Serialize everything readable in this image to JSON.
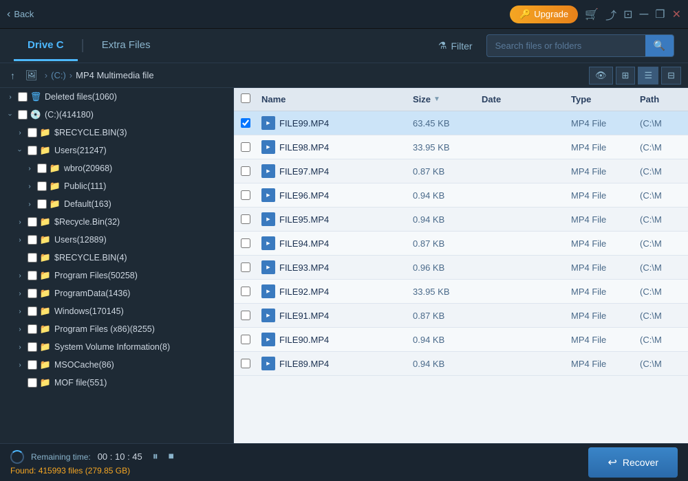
{
  "titleBar": {
    "backLabel": "Back",
    "upgradeLabel": "Upgrade",
    "upgradeIcon": "🔑"
  },
  "tabs": {
    "driveC": "Drive C",
    "extraFiles": "Extra Files",
    "filter": "Filter"
  },
  "search": {
    "placeholder": "Search files or folders"
  },
  "breadcrumb": {
    "up": "↑",
    "image": "🖼",
    "drive": "(C:)",
    "folder": "MP4 Multimedia file"
  },
  "viewModes": [
    "👁",
    "⊞",
    "☰",
    "⊟"
  ],
  "tree": {
    "items": [
      {
        "id": "deleted",
        "label": "Deleted files(1060)",
        "indent": 1,
        "type": "trash",
        "toggleState": "collapsed",
        "level": 0
      },
      {
        "id": "driveC",
        "label": "(C:)(414180)",
        "indent": 1,
        "type": "drive",
        "toggleState": "expanded",
        "level": 0
      },
      {
        "id": "srecycle1",
        "label": "$RECYCLE.BIN(3)",
        "indent": 2,
        "type": "folder",
        "toggleState": "collapsed",
        "level": 1
      },
      {
        "id": "users1",
        "label": "Users(21247)",
        "indent": 2,
        "type": "folder",
        "toggleState": "expanded",
        "level": 1
      },
      {
        "id": "wbro",
        "label": "wbro(20968)",
        "indent": 3,
        "type": "folder",
        "toggleState": "collapsed",
        "level": 2
      },
      {
        "id": "public",
        "label": "Public(111)",
        "indent": 3,
        "type": "folder",
        "toggleState": "collapsed",
        "level": 2
      },
      {
        "id": "default",
        "label": "Default(163)",
        "indent": 3,
        "type": "folder",
        "toggleState": "collapsed",
        "level": 2
      },
      {
        "id": "srecycle2",
        "label": "$Recycle.Bin(32)",
        "indent": 2,
        "type": "folder",
        "toggleState": "collapsed",
        "level": 1
      },
      {
        "id": "users2",
        "label": "Users(12889)",
        "indent": 2,
        "type": "folder",
        "toggleState": "collapsed",
        "level": 1
      },
      {
        "id": "srecycle3",
        "label": "$RECYCLE.BIN(4)",
        "indent": 2,
        "type": "folder",
        "toggleState": "none",
        "level": 1
      },
      {
        "id": "programFiles",
        "label": "Program Files(50258)",
        "indent": 2,
        "type": "folder",
        "toggleState": "collapsed",
        "level": 1
      },
      {
        "id": "programData",
        "label": "ProgramData(1436)",
        "indent": 2,
        "type": "folder",
        "toggleState": "collapsed",
        "level": 1
      },
      {
        "id": "windows",
        "label": "Windows(170145)",
        "indent": 2,
        "type": "folder",
        "toggleState": "collapsed",
        "level": 1
      },
      {
        "id": "programFilesX86",
        "label": "Program Files (x86)(8255)",
        "indent": 2,
        "type": "folder",
        "toggleState": "collapsed",
        "level": 1
      },
      {
        "id": "sysVol",
        "label": "System Volume Information(8)",
        "indent": 2,
        "type": "folder",
        "toggleState": "collapsed",
        "level": 1
      },
      {
        "id": "msoCache",
        "label": "MSOCache(86)",
        "indent": 2,
        "type": "folder",
        "toggleState": "collapsed",
        "level": 1
      },
      {
        "id": "mofFile",
        "label": "MOF file(551)",
        "indent": 2,
        "type": "folder",
        "toggleState": "none",
        "level": 1
      }
    ]
  },
  "table": {
    "headers": {
      "name": "Name",
      "size": "Size",
      "date": "Date",
      "type": "Type",
      "path": "Path"
    },
    "files": [
      {
        "id": 1,
        "name": "FILE99.MP4",
        "size": "63.45 KB",
        "date": "",
        "type": "MP4 File",
        "path": "(C:\\M",
        "selected": true
      },
      {
        "id": 2,
        "name": "FILE98.MP4",
        "size": "33.95 KB",
        "date": "",
        "type": "MP4 File",
        "path": "(C:\\M",
        "selected": false
      },
      {
        "id": 3,
        "name": "FILE97.MP4",
        "size": "0.87 KB",
        "date": "",
        "type": "MP4 File",
        "path": "(C:\\M",
        "selected": false
      },
      {
        "id": 4,
        "name": "FILE96.MP4",
        "size": "0.94 KB",
        "date": "",
        "type": "MP4 File",
        "path": "(C:\\M",
        "selected": false
      },
      {
        "id": 5,
        "name": "FILE95.MP4",
        "size": "0.94 KB",
        "date": "",
        "type": "MP4 File",
        "path": "(C:\\M",
        "selected": false
      },
      {
        "id": 6,
        "name": "FILE94.MP4",
        "size": "0.87 KB",
        "date": "",
        "type": "MP4 File",
        "path": "(C:\\M",
        "selected": false
      },
      {
        "id": 7,
        "name": "FILE93.MP4",
        "size": "0.96 KB",
        "date": "",
        "type": "MP4 File",
        "path": "(C:\\M",
        "selected": false
      },
      {
        "id": 8,
        "name": "FILE92.MP4",
        "size": "33.95 KB",
        "date": "",
        "type": "MP4 File",
        "path": "(C:\\M",
        "selected": false
      },
      {
        "id": 9,
        "name": "FILE91.MP4",
        "size": "0.87 KB",
        "date": "",
        "type": "MP4 File",
        "path": "(C:\\M",
        "selected": false
      },
      {
        "id": 10,
        "name": "FILE90.MP4",
        "size": "0.94 KB",
        "date": "",
        "type": "MP4 File",
        "path": "(C:\\M",
        "selected": false
      },
      {
        "id": 11,
        "name": "FILE89.MP4",
        "size": "0.94 KB",
        "date": "",
        "type": "MP4 File",
        "path": "(C:\\M",
        "selected": false
      }
    ]
  },
  "statusBar": {
    "remainingLabel": "Remaining time:",
    "remainingTime": "00 : 10 : 45",
    "foundLabel": "Found: 415993 files (279.85 GB)",
    "recoverLabel": "Recover"
  }
}
